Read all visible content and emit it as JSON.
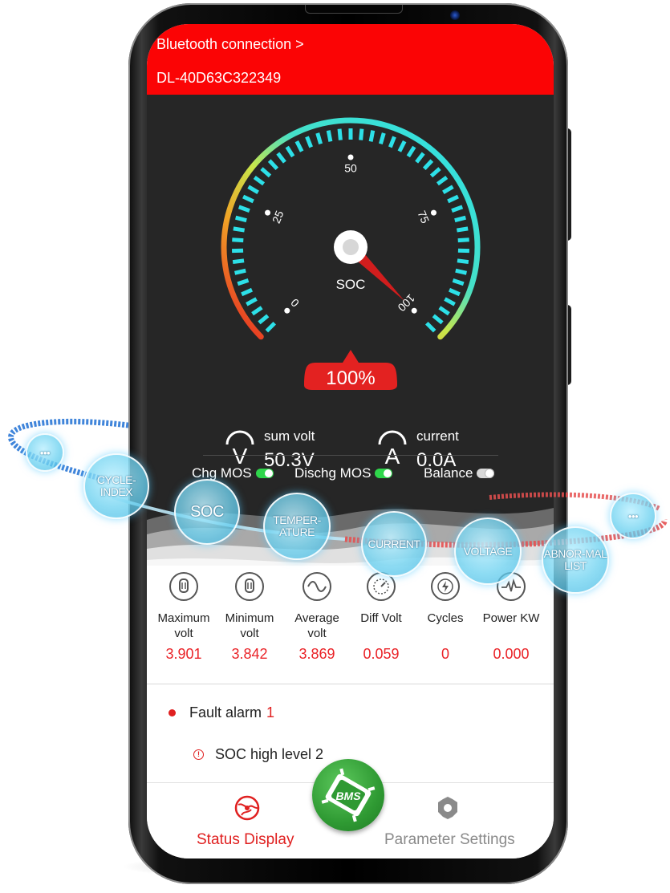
{
  "header": {
    "connection_label": "Bluetooth connection >",
    "device_id": "DL-40D63C322349"
  },
  "gauge": {
    "label": "SOC",
    "value_pct": 100,
    "display": "100%",
    "ticks": [
      "0",
      "25",
      "50",
      "75",
      "100"
    ]
  },
  "stats": {
    "sum_volt_label": "sum volt",
    "sum_volt_value": "50.3V",
    "current_label": "current",
    "current_value": "0.0A"
  },
  "mos": {
    "chg_label": "Chg MOS",
    "chg_on": true,
    "dischg_label": "Dischg MOS",
    "dischg_on": true,
    "balance_label": "Balance",
    "balance_on": false
  },
  "metrics": [
    {
      "label": "Maximum volt",
      "line1": "Maximum",
      "line2": "volt",
      "value": "3.901",
      "icon": "battery-u-icon"
    },
    {
      "label": "Minimum volt",
      "line1": "Minimum",
      "line2": "volt",
      "value": "3.842",
      "icon": "battery-u-icon"
    },
    {
      "label": "Average volt",
      "line1": "Average",
      "line2": "volt",
      "value": "3.869",
      "icon": "wave-icon"
    },
    {
      "label": "Diff Volt",
      "line1": "Diff Volt",
      "line2": "",
      "value": "0.059",
      "icon": "gauge-icon"
    },
    {
      "label": "Cycles",
      "line1": "Cycles",
      "line2": "",
      "value": "0",
      "icon": "bolt-cycle-icon"
    },
    {
      "label": "Power KW",
      "line1": "Power KW",
      "line2": "",
      "value": "0.000",
      "icon": "pulse-icon"
    }
  ],
  "faults": {
    "title": "Fault alarm",
    "count": "1",
    "items": [
      "SOC high level 2"
    ]
  },
  "tabs": {
    "status": "Status Display",
    "center": "BMS",
    "settings": "Parameter Settings"
  },
  "bubbles": {
    "more_left": "•••",
    "cycle_index": "CYCLE-INDEX",
    "soc": "SOC",
    "temperature": "TEMPER-ATURE",
    "current": "CURRENT",
    "voltage": "VOLTAGE",
    "abnormal": "ABNOR-MAL LIST",
    "more_right": "•••"
  },
  "colors": {
    "header_red": "#fb0405",
    "dark_panel": "#262626",
    "gauge_cyan": "#2de0e8",
    "value_red": "#ea2328",
    "toggle_green": "#2fd64b",
    "bms_green": "#2f9a33"
  }
}
